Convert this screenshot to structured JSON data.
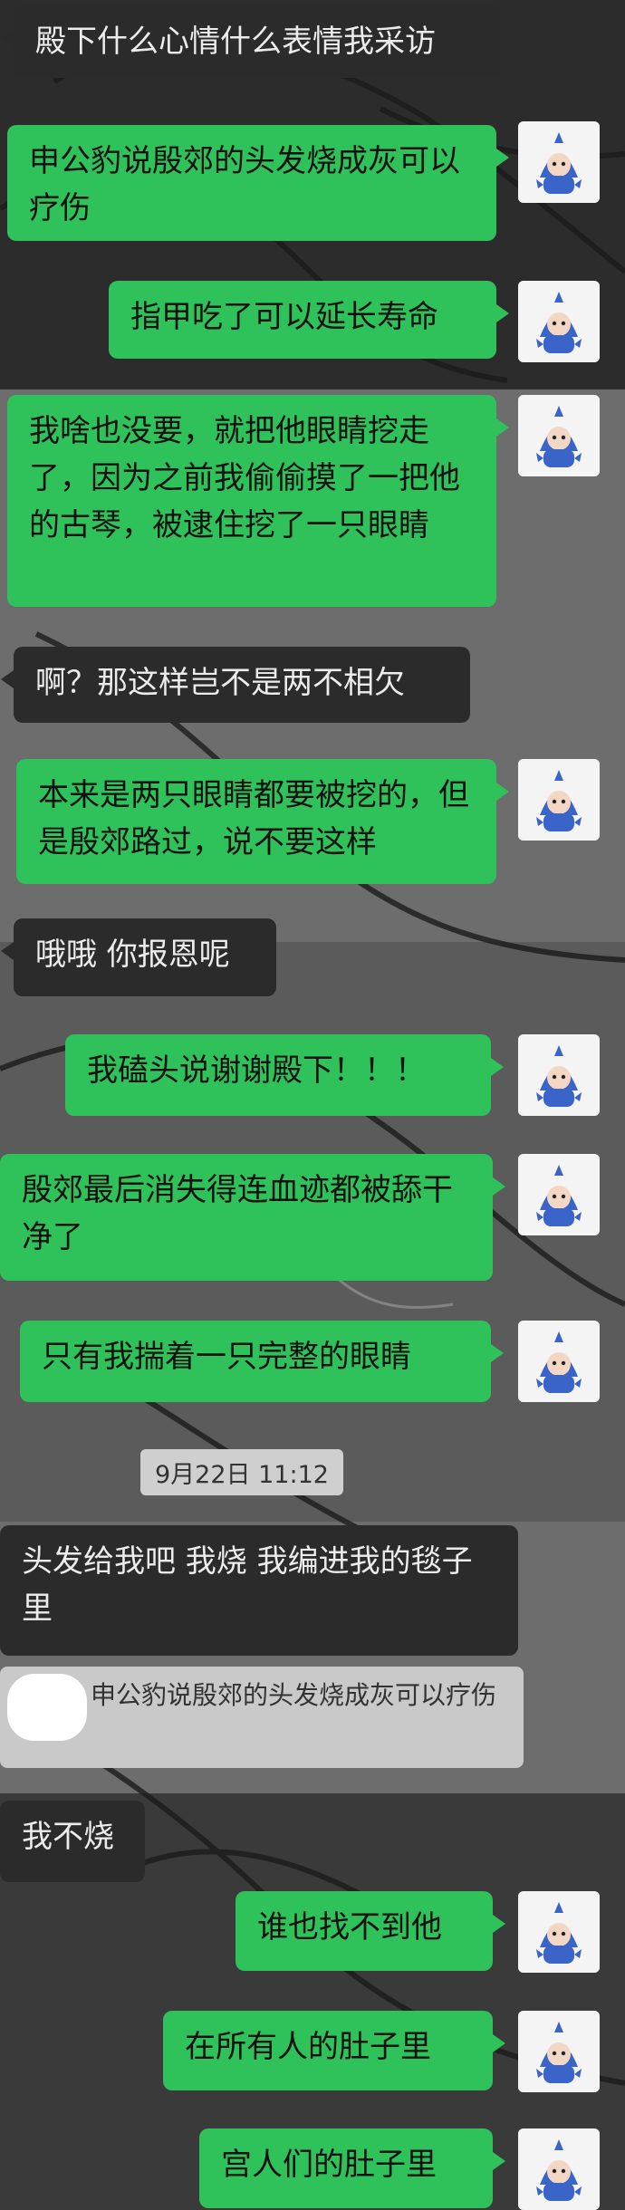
{
  "colors": {
    "sent_bubble": "#2fc25b",
    "received_bubble": "#2b2b2b",
    "timestamp_bg": "#cfcfcf"
  },
  "messages": [
    {
      "side": "left",
      "text": "殿下什么心情什么表情我采访"
    },
    {
      "side": "right",
      "text": "申公豹说殷郊的头发烧成灰可以疗伤"
    },
    {
      "side": "right",
      "text": "指甲吃了可以延长寿命"
    },
    {
      "side": "right",
      "text": "我啥也没要，就把他眼睛挖走了，因为之前我偷偷摸了一把他的古琴，被逮住挖了一只眼睛"
    },
    {
      "side": "left",
      "text": "啊？那这样岂不是两不相欠"
    },
    {
      "side": "right",
      "text": "本来是两只眼睛都要被挖的，但是殷郊路过，说不要这样"
    },
    {
      "side": "left",
      "text": "哦哦 你报恩呢"
    },
    {
      "side": "right",
      "text": "我磕头说谢谢殿下！！！"
    },
    {
      "side": "right",
      "text": "殷郊最后消失得连血迹都被舔干净了"
    },
    {
      "side": "right",
      "text": "只有我揣着一只完整的眼睛"
    },
    {
      "side": "left",
      "text": "头发给我吧 我烧 我编进我的毯子里"
    },
    {
      "side": "left",
      "text": "我不烧"
    },
    {
      "side": "right",
      "text": "谁也找不到他"
    },
    {
      "side": "right",
      "text": "在所有人的肚子里"
    },
    {
      "side": "right",
      "text": "宫人们的肚子里"
    }
  ],
  "timestamp": "9月22日 11:12",
  "quote": {
    "text": "申公豹说殷郊的头发烧成灰可以疗伤"
  },
  "avatar_icon": "blue-shark-hood-avatar"
}
